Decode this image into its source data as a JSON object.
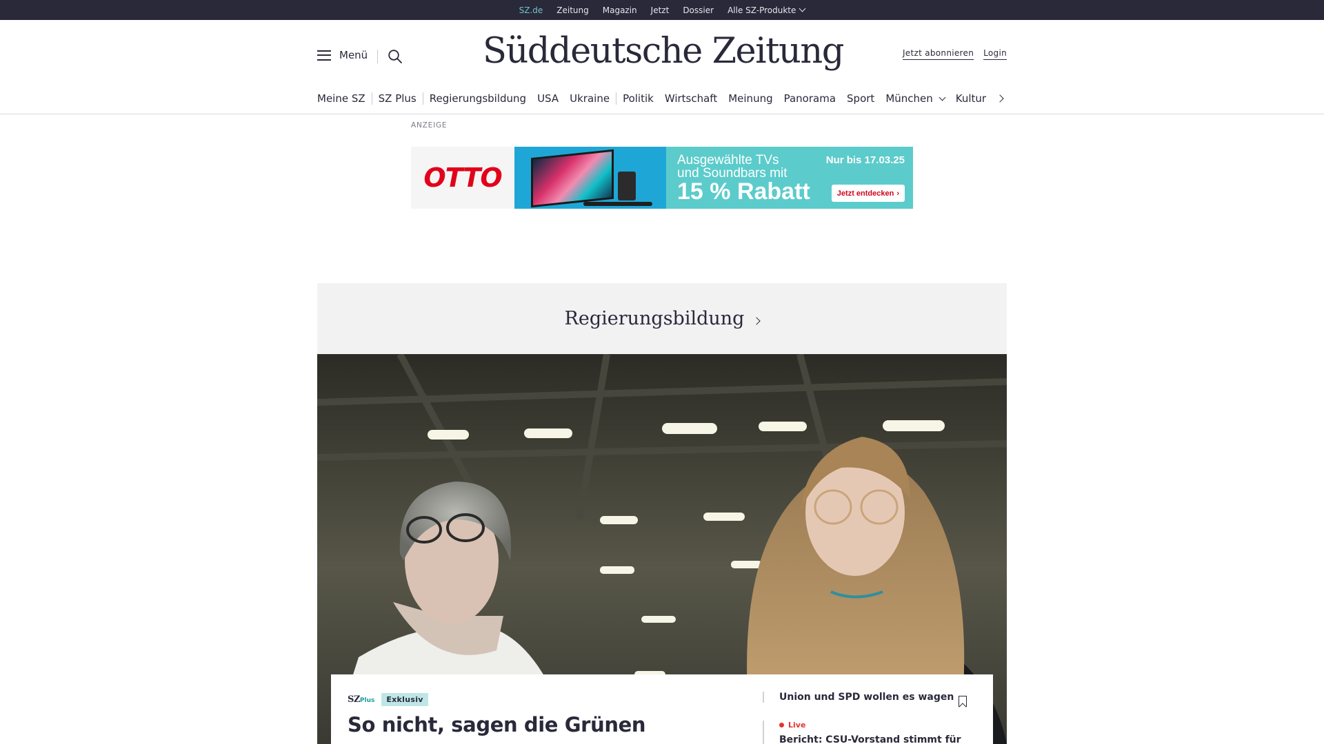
{
  "topbar": {
    "links": [
      "SZ.de",
      "Zeitung",
      "Magazin",
      "Jetzt",
      "Dossier"
    ],
    "products_label": "Alle SZ-Produkte"
  },
  "header": {
    "menu_label": "Menü",
    "logo_text": "Süddeutsche Zeitung",
    "subscribe_label": "Jetzt abonnieren",
    "login_label": "Login"
  },
  "ressorts": {
    "items": [
      "Meine SZ",
      "SZ Plus",
      "Regierungsbildung",
      "USA",
      "Ukraine",
      "Politik",
      "Wirtschaft",
      "Meinung",
      "Panorama",
      "Sport",
      "München",
      "Kultur"
    ]
  },
  "ad": {
    "label": "ANZEIGE",
    "brand": "OTTO",
    "line1": "Ausgewählte TVs",
    "line2": "und Soundbars mit",
    "big": "15 % Rabatt",
    "until": "Nur bis 17.03.25",
    "cta": "Jetzt entdecken"
  },
  "section": {
    "title": "Regierungsbildung"
  },
  "teaser": {
    "plus_brand": "SZ",
    "plus_suffix": "Plus",
    "badge": "Exklusiv",
    "headline": "So nicht, sagen die Grünen",
    "related_title": "Union und SPD wollen es wagen",
    "live_label": "Live",
    "live_title": "Bericht: CSU-Vorstand stimmt für"
  },
  "colors": {
    "topbar_bg": "#29293a",
    "accent_teal": "#71c3c7",
    "live_red": "#e3342f",
    "otto_red": "#e2001a"
  },
  "icons": [
    "hamburger-icon",
    "search-icon",
    "chevron-down-icon",
    "chevron-right-icon",
    "bookmark-icon",
    "live-dot-icon"
  ]
}
